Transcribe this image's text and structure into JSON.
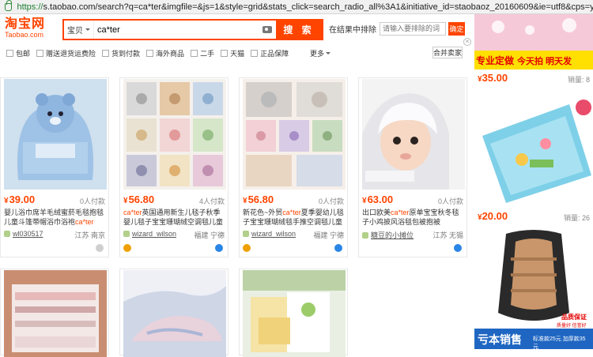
{
  "browser": {
    "scheme": "https://",
    "url": "s.taobao.com/search?q=ca*ter&imgfile=&js=1&style=grid&stats_click=search_radio_all%3A1&initiative_id=staobaoz_20160609&ie=utf8&cps=yes&cat=50"
  },
  "header": {
    "logo_cn": "淘宝网",
    "logo_en": "Taobao.com",
    "search_tab": "宝贝",
    "search_value": "ca*ter",
    "search_button": "搜 索",
    "in_results_label": "在结果中排除",
    "in_results_placeholder": "请输入要排除的词",
    "confirm_button": "确定",
    "close_glyph": "×"
  },
  "filters": {
    "options": [
      "包邮",
      "赠送退货运费险",
      "货到付款",
      "海外商品",
      "二手",
      "天猫",
      "正品保障"
    ],
    "more_label": "更多",
    "merge_label": "合并卖家"
  },
  "products": [
    {
      "price": "39.00",
      "paid": "0人付款",
      "title_pre": "婴儿浴巾席羊毛绒蜜菸毛毯抱毯儿童斗篷带帽浴巾浴袍",
      "title_hl": "ca*ter",
      "title_post": "",
      "shop": "wl030517",
      "location": "江苏 南京"
    },
    {
      "price": "56.80",
      "paid": "4人付款",
      "title_pre": "",
      "title_hl": "ca*ter",
      "title_post": "英国通用新生儿毯子秋季婴儿毯子宝宝珊瑚绒空调毯儿童抱被",
      "shop": "wizard_wilson",
      "location": "福建 宁德"
    },
    {
      "price": "56.80",
      "paid": "0人付款",
      "title_pre": "新花色~外贸",
      "title_hl": "ca*ter",
      "title_post": "夏季婴幼儿毯子宝宝珊瑚绒毯手推空调毯儿童抱被",
      "shop": "wizard_wilson",
      "location": "福建 宁德"
    },
    {
      "price": "63.00",
      "paid": "0人付款",
      "title_pre": "出口欧美",
      "title_hl": "ca*ter",
      "title_post": "原单宝宝秋冬毯子小鸡披风浴毯包被抱被",
      "shop": "糖豆的小摊位",
      "location": "江苏 无锡"
    }
  ],
  "right_items": [
    {
      "banner_a": "专业定做",
      "banner_b": "今天拍 明天发",
      "price": "35.00",
      "sold": "销量: 8"
    },
    {
      "price": "20.00",
      "sold": "销量: 26"
    },
    {
      "overlay_a": "品质保证",
      "overlay_b": "质量好 信誉好",
      "footer": "亏本销售",
      "footer_small": "标准款25元 加厚款35元"
    }
  ],
  "colors": {
    "accent": "#ff4400"
  },
  "currency": "¥"
}
